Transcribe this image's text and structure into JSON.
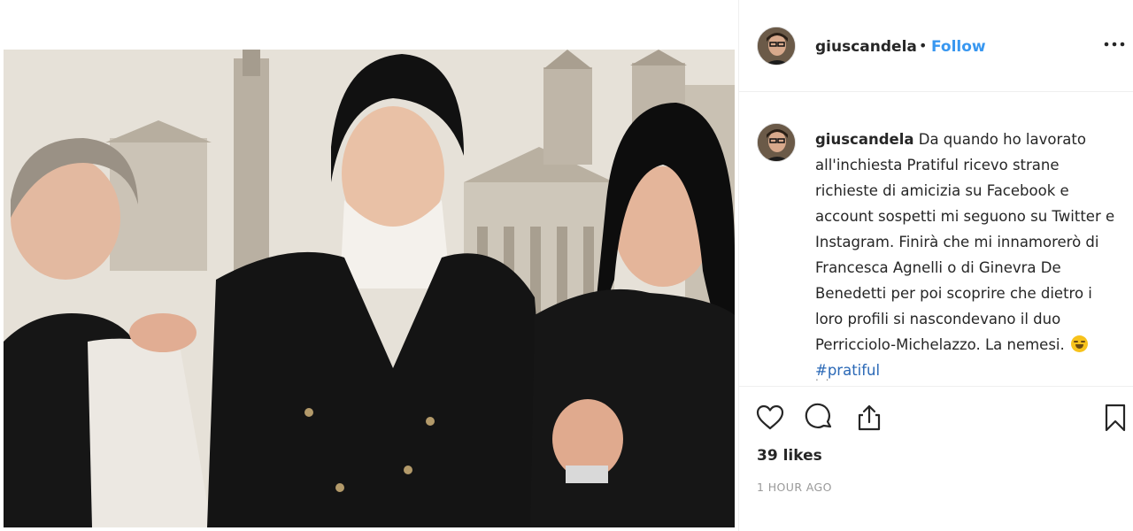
{
  "post": {
    "username": "giuscandela",
    "separator": "•",
    "follow_label": "Follow",
    "more_icon": "more-options-icon",
    "caption": {
      "username": "giuscandela",
      "text": "Da quando ho lavorato all'inchiesta Pratiful ricevo strane richieste di amicizia su Facebook e account sospetti mi seguono su Twitter e Instagram. Finirà che mi innamorerò di Francesca Agnelli o di Ginevra De Benedetti per poi scoprire che dietro i loro profili si nascondevano il duo Perricciolo-Michelazzo. La nemesi.",
      "emoji": "laughing-emoji-icon",
      "hashtag": "#pratiful",
      "truncated_marker": ". ."
    },
    "likes": "39 likes",
    "timestamp": "1 HOUR AGO",
    "icons": {
      "like": "heart-icon",
      "comment": "comment-icon",
      "share": "share-icon",
      "save": "bookmark-icon"
    },
    "colors": {
      "link": "#3897f0",
      "border": "#efefef",
      "text": "#262626",
      "muted": "#999999"
    }
  }
}
